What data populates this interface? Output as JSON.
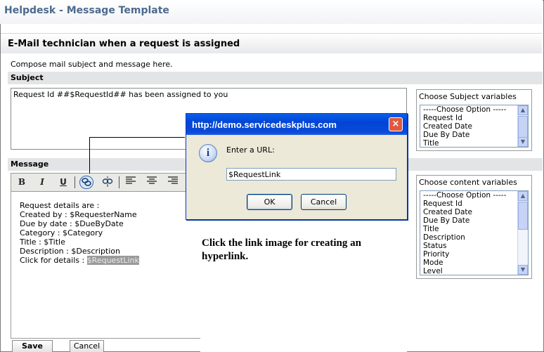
{
  "app": {
    "title": "Helpdesk - Message Template"
  },
  "page": {
    "heading": "E-Mail technician when a request is assigned",
    "instruction": "Compose mail subject and message here."
  },
  "subject": {
    "label": "Subject",
    "value": "Request Id ##$RequestId## has been assigned to you"
  },
  "subject_variables": {
    "title": "Choose Subject variables",
    "options": [
      "-----Choose Option -----",
      "Request Id",
      "Created Date",
      "Due By Date",
      "Title"
    ]
  },
  "message": {
    "label": "Message",
    "toolbar": {
      "bold": "B",
      "italic": "I",
      "underline": "U"
    },
    "lines": [
      "Request details are :",
      "",
      "Created by : $RequesterName",
      "Due by date : $DueByDate",
      "Category : $Category",
      "Title : $Title",
      "Description : $Description"
    ],
    "link_prefix": "Click for details : ",
    "link_text": "$RequestLink"
  },
  "content_variables": {
    "title": "Choose content variables",
    "options": [
      "-----Choose Option -----",
      "Request Id",
      "Created Date",
      "Due By Date",
      "Title",
      "Description",
      "Status",
      "Priority",
      "Mode",
      "Level"
    ]
  },
  "dialog": {
    "title": "http://demo.servicedeskplus.com",
    "close": "×",
    "info_glyph": "i",
    "prompt": "Enter a URL:",
    "input_value": "$RequestLink",
    "ok": "OK",
    "cancel": "Cancel"
  },
  "annotation": {
    "text": "Click the link image for creating an hyperlink."
  },
  "buttons": {
    "save": "Save",
    "cancel": "Cancel"
  }
}
